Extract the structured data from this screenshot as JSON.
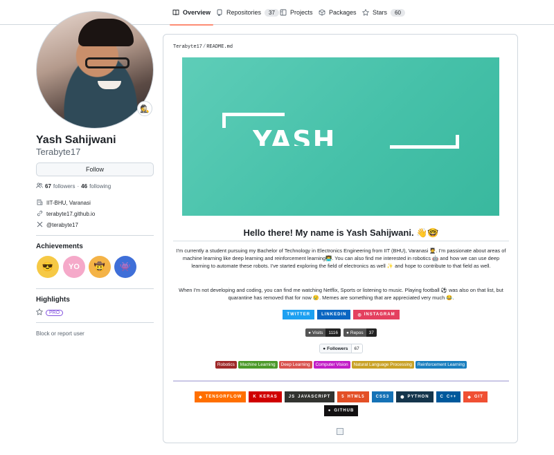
{
  "nav": {
    "tabs": [
      {
        "label": "Overview",
        "icon": "book-icon",
        "count": ""
      },
      {
        "label": "Repositories",
        "icon": "repo-icon",
        "count": "37"
      },
      {
        "label": "Projects",
        "icon": "project-icon",
        "count": ""
      },
      {
        "label": "Packages",
        "icon": "package-icon",
        "count": ""
      },
      {
        "label": "Stars",
        "icon": "star-icon",
        "count": "60"
      }
    ]
  },
  "profile": {
    "fullname": "Yash Sahijwani",
    "login": "Terabyte17",
    "follow_label": "Follow",
    "followers_count": "67",
    "followers_label": "followers",
    "following_count": "46",
    "following_label": "following",
    "separator": "·",
    "org": "IIT-BHU, Varanasi",
    "website": "terabyte17.github.io",
    "x_handle": "@terabyte17",
    "status_emoji": "🕵"
  },
  "achievements": {
    "title": "Achievements",
    "items": [
      {
        "name": "achievement-1",
        "glyph": "😎",
        "bg": "#f6c945"
      },
      {
        "name": "achievement-yolo",
        "glyph": "YO",
        "bg": "#f5a9c9"
      },
      {
        "name": "achievement-3",
        "glyph": "🤠",
        "bg": "#f4b347"
      },
      {
        "name": "achievement-4",
        "glyph": "👾",
        "bg": "#3f6fd8"
      }
    ]
  },
  "highlights": {
    "title": "Highlights",
    "pro_label": "PRO"
  },
  "block_label": "Block or report user",
  "readme": {
    "owner": "Terabyte17",
    "file": "README.md",
    "path_sep": "/",
    "banner_text": "YASH SAHIJWANI",
    "heading": "Hello there! My name is Yash Sahijwani. 👋🤓",
    "para1": "I'm currently a student pursuing my Bachelor of Technology in Electronics Engineering from IIT (BHU), Varanasi 🧑‍🎓. I'm passionate about areas of machine learning like deep learning and reinforcement learning👨‍💻. You can also find me interested in robotics 🤖 and how we can use deep learning to automate these robots. I've started exploring the field of electronics as well ✨ and hope to contribute to that field as well.",
    "para2": "When I'm not developing and coding, you can find me watching Netflix, Sports or listening to music. Playing football ⚽ was also on that list, but quarantine has removed that for now 😢. Memes are something that are appreciated very much 😂.",
    "socials": [
      {
        "label": "TWITTER",
        "bg": "#1ca0f1"
      },
      {
        "label": "LINKEDIN",
        "bg": "#0a66c2"
      },
      {
        "label": "INSTAGRAM",
        "bg": "#e4405f"
      }
    ],
    "visits_label": "Visits",
    "visits_value": "1116",
    "repos_label": "Repos",
    "repos_value": "37",
    "followers_label": "Followers",
    "followers_value": "67",
    "topics": [
      {
        "label": "Robotics",
        "bg": "#9f2a2a"
      },
      {
        "label": "Machine Learning",
        "bg": "#4c9a2a"
      },
      {
        "label": "Deep Learning",
        "bg": "#d9534f"
      },
      {
        "label": "Computer Vision",
        "bg": "#c21ec7"
      },
      {
        "label": "Natural Language Processing",
        "bg": "#c9a227"
      },
      {
        "label": "Reinforcement Learning",
        "bg": "#1a7fbf"
      }
    ],
    "tech": [
      {
        "label": "TENSORFLOW",
        "glyph": "◆",
        "bg": "#ff6f00"
      },
      {
        "label": "KERAS",
        "glyph": "K",
        "bg": "#d00000"
      },
      {
        "label": "JAVASCRIPT",
        "glyph": "JS",
        "bg": "#323330"
      },
      {
        "label": "HTML5",
        "glyph": "5",
        "bg": "#e34f26"
      },
      {
        "label": "CSS3",
        "glyph": "",
        "bg": "#1572b6"
      },
      {
        "label": "PYTHON",
        "glyph": "⬢",
        "bg": "#14354c"
      },
      {
        "label": "C++",
        "glyph": "C",
        "bg": "#00599c"
      },
      {
        "label": "GIT",
        "glyph": "◆",
        "bg": "#f05033"
      }
    ],
    "github_label": "GITHUB"
  }
}
